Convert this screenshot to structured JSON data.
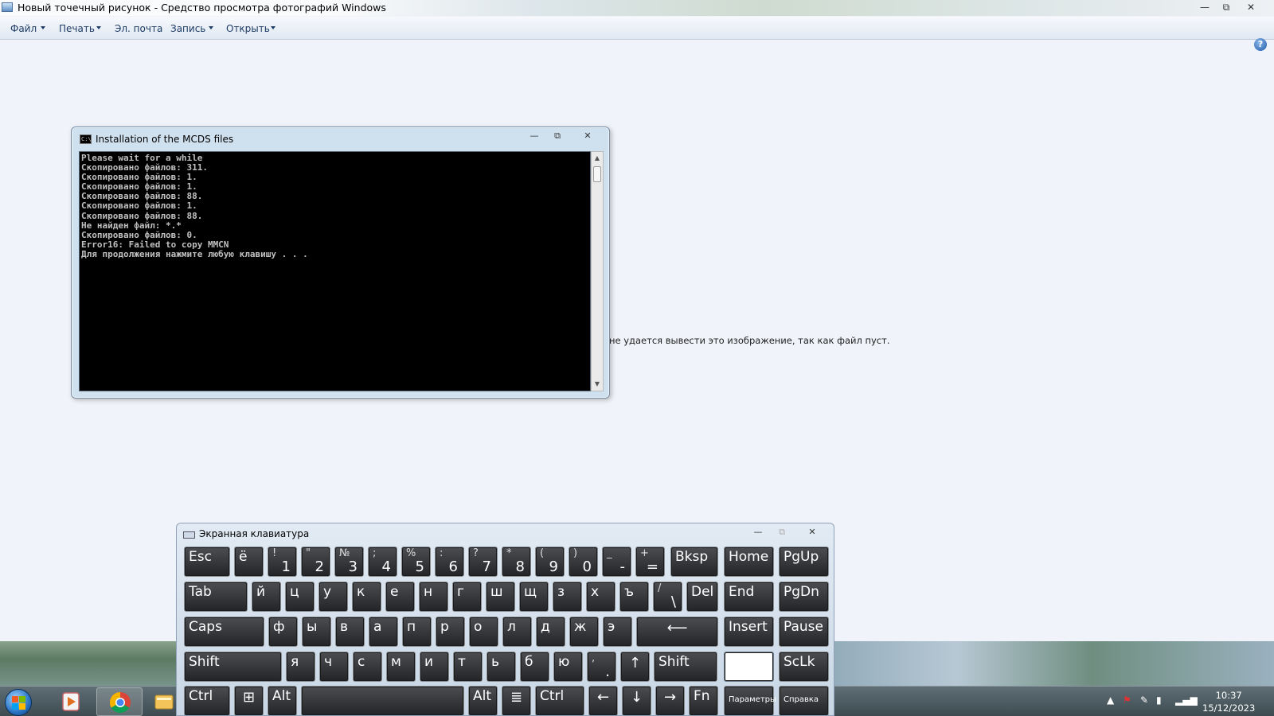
{
  "window": {
    "title": "Новый точечный рисунок - Средство просмотра фотографий Windows",
    "controls": {
      "minimize": "—",
      "restore": "⧉",
      "close": "✕"
    }
  },
  "menu": {
    "items": [
      {
        "label": "Файл",
        "dropdown": true
      },
      {
        "label": "Печать",
        "dropdown": true
      },
      {
        "label": "Эл. почта",
        "dropdown": false
      },
      {
        "label": "Запись",
        "dropdown": true
      },
      {
        "label": "Открыть",
        "dropdown": true
      }
    ],
    "help_glyph": "?"
  },
  "viewer": {
    "message": "не удается вывести это изображение, так как файл пуст."
  },
  "cmd": {
    "title": "Installation of the MCDS files",
    "icon_text": "C:\\",
    "lines": [
      "Please wait for a while",
      "Скопировано файлов: 311.",
      "Скопировано файлов: 1.",
      "Скопировано файлов: 1.",
      "Скопировано файлов: 88.",
      "Скопировано файлов: 1.",
      "Скопировано файлов: 88.",
      "Не найден файл: *.*",
      "Скопировано файлов: 0.",
      "Error16: Failed to copy MMCN",
      "Для продолжения нажмите любую клавишу . . ."
    ],
    "scroll_up": "▲",
    "scroll_down": "▼"
  },
  "osk": {
    "title": "Экранная клавиатура",
    "rows": [
      [
        {
          "main": "Esc"
        },
        {
          "main": "ё"
        },
        {
          "top": "!",
          "bottom": "1"
        },
        {
          "top": "\"",
          "bottom": "2"
        },
        {
          "top": "№",
          "bottom": "3"
        },
        {
          "top": ";",
          "bottom": "4"
        },
        {
          "top": "%",
          "bottom": "5"
        },
        {
          "top": ":",
          "bottom": "6"
        },
        {
          "top": "?",
          "bottom": "7"
        },
        {
          "top": "*",
          "bottom": "8"
        },
        {
          "top": "(",
          "bottom": "9"
        },
        {
          "top": ")",
          "bottom": "0"
        },
        {
          "top": "_",
          "bottom": "-"
        },
        {
          "top": "+",
          "bottom": "="
        },
        {
          "main": "Bksp"
        },
        {
          "main": "Home"
        },
        {
          "main": "PgUp"
        }
      ],
      [
        {
          "main": "Tab"
        },
        {
          "main": "й"
        },
        {
          "main": "ц"
        },
        {
          "main": "у"
        },
        {
          "main": "к"
        },
        {
          "main": "е"
        },
        {
          "main": "н"
        },
        {
          "main": "г"
        },
        {
          "main": "ш"
        },
        {
          "main": "щ"
        },
        {
          "main": "з"
        },
        {
          "main": "х"
        },
        {
          "main": "ъ"
        },
        {
          "top": "/",
          "bottom": "\\"
        },
        {
          "main": "Del"
        },
        {
          "main": "End"
        },
        {
          "main": "PgDn"
        }
      ],
      [
        {
          "main": "Caps"
        },
        {
          "main": "ф"
        },
        {
          "main": "ы"
        },
        {
          "main": "в"
        },
        {
          "main": "а"
        },
        {
          "main": "п"
        },
        {
          "main": "р"
        },
        {
          "main": "о"
        },
        {
          "main": "л"
        },
        {
          "main": "д"
        },
        {
          "main": "ж"
        },
        {
          "main": "э"
        },
        {
          "main": "⟵"
        },
        {
          "main": "Insert"
        },
        {
          "main": "Pause"
        }
      ],
      [
        {
          "main": "Shift"
        },
        {
          "main": "я"
        },
        {
          "main": "ч"
        },
        {
          "main": "с"
        },
        {
          "main": "м"
        },
        {
          "main": "и"
        },
        {
          "main": "т"
        },
        {
          "main": "ь"
        },
        {
          "main": "б"
        },
        {
          "main": "ю"
        },
        {
          "top": ",",
          "bottom": "."
        },
        {
          "main": "↑"
        },
        {
          "main": "Shift"
        },
        {
          "main": ""
        },
        {
          "main": "ScLk"
        }
      ],
      [
        {
          "main": "Ctrl"
        },
        {
          "main": "⊞"
        },
        {
          "main": "Alt"
        },
        {
          "main": ""
        },
        {
          "main": "Alt"
        },
        {
          "main": "≣"
        },
        {
          "main": "Ctrl"
        },
        {
          "main": "←"
        },
        {
          "main": "↓"
        },
        {
          "main": "→"
        },
        {
          "main": "Fn"
        },
        {
          "main": "Параметры"
        },
        {
          "main": "Справка"
        }
      ]
    ]
  },
  "taskbar": {
    "pinned": [
      "start-icon",
      "media-player-icon",
      "chrome-icon",
      "explorer-icon"
    ],
    "tray": {
      "arrow": "▲",
      "icons": [
        "flag-icon",
        "network-pen-icon",
        "power-icon",
        "signal-icon"
      ]
    },
    "time": "10:37",
    "date": "15/12/2023"
  }
}
